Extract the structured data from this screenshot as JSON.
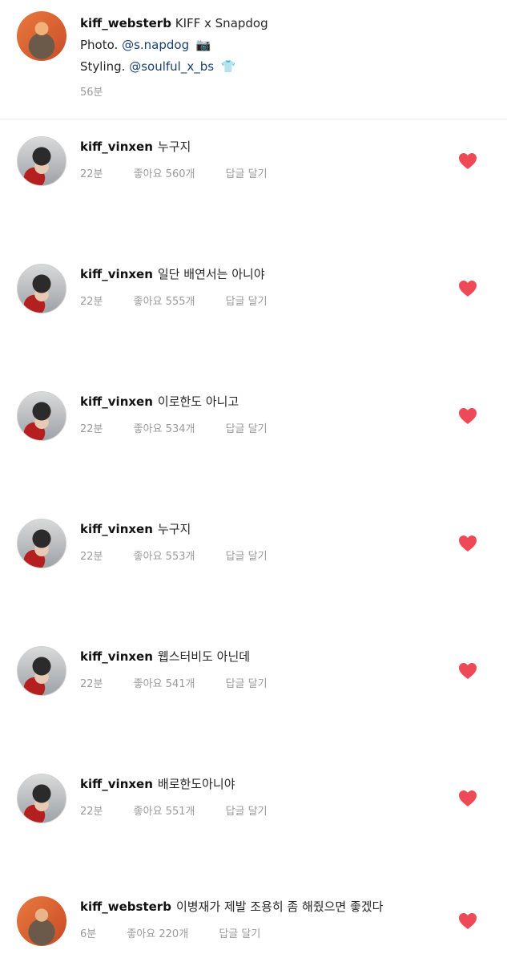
{
  "caption": {
    "username": "kiff_websterb",
    "title_text": "KIFF x Snapdog",
    "photo_label": "Photo.",
    "photo_mention": "@s.napdog",
    "photo_emoji": "📷",
    "styling_label": "Styling.",
    "styling_mention": "@soulful_x_bs",
    "styling_emoji": "👕",
    "time": "56분"
  },
  "comments": [
    {
      "username": "kiff_vinxen",
      "text": "누구지",
      "time": "22분",
      "likes": "좋아요 560개",
      "reply": "답글 달기"
    },
    {
      "username": "kiff_vinxen",
      "text": "일단 배연서는 아니야",
      "time": "22분",
      "likes": "좋아요 555개",
      "reply": "답글 달기"
    },
    {
      "username": "kiff_vinxen",
      "text": "이로한도 아니고",
      "time": "22분",
      "likes": "좋아요 534개",
      "reply": "답글 달기"
    },
    {
      "username": "kiff_vinxen",
      "text": "누구지",
      "time": "22분",
      "likes": "좋아요 553개",
      "reply": "답글 달기"
    },
    {
      "username": "kiff_vinxen",
      "text": "웹스터비도 아닌데",
      "time": "22분",
      "likes": "좋아요 541개",
      "reply": "답글 달기"
    },
    {
      "username": "kiff_vinxen",
      "text": "배로한도아니야",
      "time": "22분",
      "likes": "좋아요 551개",
      "reply": "답글 달기"
    },
    {
      "username": "kiff_websterb",
      "text": "이병재가 제발 조용히 좀 해줬으면 좋겠다",
      "time": "6분",
      "likes": "좋아요 220개",
      "reply": "답글 달기"
    }
  ],
  "colors": {
    "heart": "#ed4956",
    "mention": "#1a3f73",
    "muted": "#9a9a9a"
  },
  "icons": {
    "like": "heart-icon"
  }
}
